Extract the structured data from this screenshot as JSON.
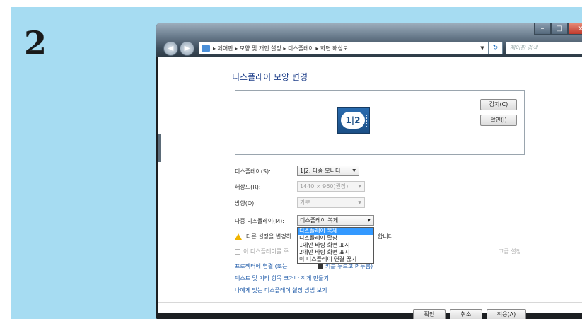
{
  "step": {
    "number": "2"
  },
  "window": {
    "breadcrumb": "▸ 제어판 ▸ 모양 및 개인 설정 ▸ 디스플레이 ▸ 화면 해상도",
    "search_placeholder": "제어판 검색",
    "controls": {
      "minimize": "–",
      "maximize": "□",
      "close": "x"
    }
  },
  "page": {
    "title": "디스플레이 모양 변경",
    "preview": {
      "monitor_label": "1|2",
      "detect_button": "감지(C)",
      "identify_button": "확인(I)"
    },
    "form": {
      "display_label": "디스플레이(S):",
      "display_value": "1|2. 다중 모니터",
      "resolution_label": "해상도(R):",
      "resolution_value": "1440 × 960(권장)",
      "orientation_label": "방향(O):",
      "orientation_value": "가로",
      "multi_display_label": "다중 디스플레이(M):",
      "multi_display_value": "디스플레이 복제"
    },
    "dropdown_options": [
      {
        "label": "디스플레이 복제",
        "selected": true
      },
      {
        "label": "디스플레이 확장",
        "selected": false
      },
      {
        "label": "1에만 바탕 화면 표시",
        "selected": false
      },
      {
        "label": "2에만 바탕 화면 표시",
        "selected": false
      },
      {
        "label": "이 디스플레이 연결 끊기",
        "selected": false
      }
    ],
    "warning_text": "다른 설정을 변경하",
    "warning_tail": "합니다.",
    "main_display_checkbox": "이 디스플레이를 주",
    "advanced_link": "고급 설정",
    "links": {
      "projector": "프로젝터에 연결 (또는",
      "projector_tail": "키를 누르고 P 누름)",
      "text_size": "텍스트 및 기타 항목 크거나 작게 만들기",
      "help": "나에게 맞는 디스플레이 설정 방법 보기"
    },
    "buttons": {
      "ok": "확인",
      "cancel": "취소",
      "apply": "적용(A)"
    }
  },
  "colors": {
    "background": "#a6dcf2",
    "link": "#1e5aa8",
    "selection": "#3399ff"
  }
}
